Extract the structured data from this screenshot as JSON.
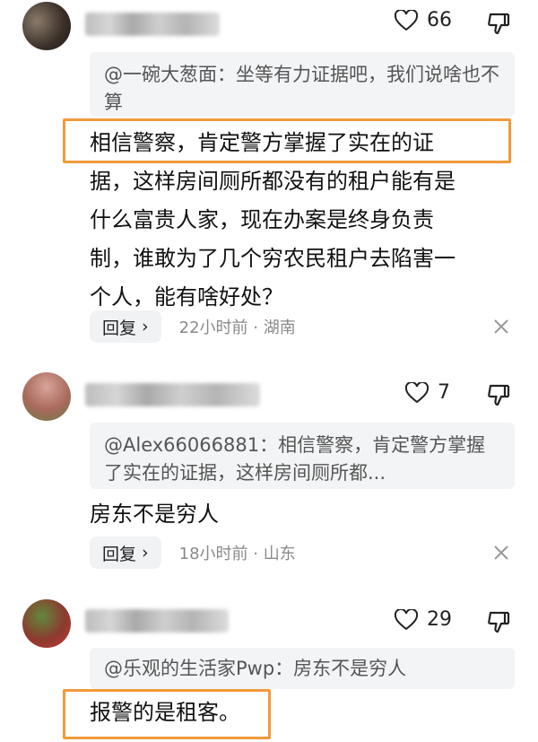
{
  "comments": [
    {
      "likes": "66",
      "quote": "@一碗大葱面：坐等有力证据吧，我们说啥也不算",
      "body_lines": [
        "相信警察，肯定警方掌握了实在的证",
        "据，这样房间厕所都没有的租户能有是",
        "什么富贵人家，现在办案是终身负责",
        "制，谁敢为了几个穷农民租户去陷害一",
        "个人，能有啥好处？"
      ],
      "reply_label": "回复",
      "time": "22小时前",
      "location": "湖南"
    },
    {
      "likes": "7",
      "quote": "@Alex66066881：相信警察，肯定警方掌握了实在的证据，这样房间厕所都...",
      "body_lines": [
        "房东不是穷人"
      ],
      "reply_label": "回复",
      "time": "18小时前",
      "location": "山东"
    },
    {
      "likes": "29",
      "quote": "@乐观的生活家Pwp：房东不是穷人",
      "body_lines": [
        "报警的是租客。"
      ]
    }
  ],
  "colors": {
    "highlight": "#f19a3a",
    "quote_bg": "#f3f4f6",
    "meta_text": "#8a8a8a"
  },
  "icons": [
    "heart-outline-icon",
    "thumb-down-icon",
    "chevron-right-icon",
    "close-icon"
  ]
}
